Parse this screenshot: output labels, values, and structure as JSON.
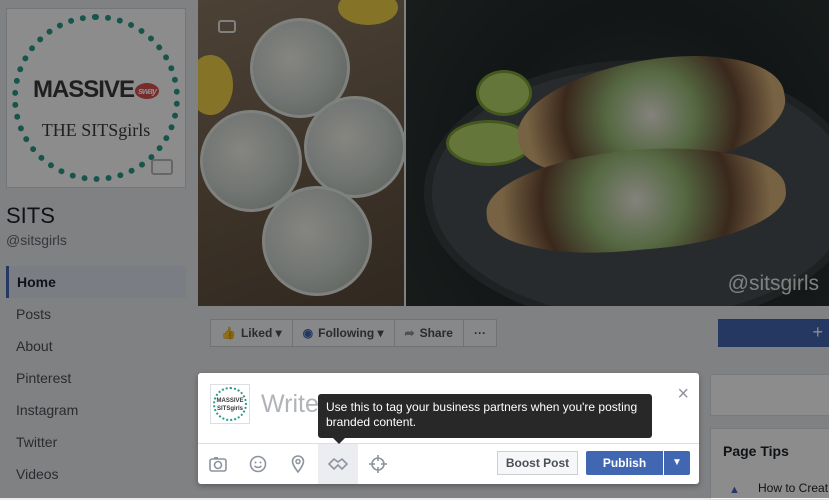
{
  "page": {
    "name": "SITS",
    "handle": "@sitsgirls",
    "logo_line1": "MASSIVE",
    "logo_badge": "sway",
    "logo_line2": "THE SITSgirls"
  },
  "nav": {
    "items": [
      {
        "label": "Home",
        "active": true
      },
      {
        "label": "Posts"
      },
      {
        "label": "About"
      },
      {
        "label": "Pinterest"
      },
      {
        "label": "Instagram"
      },
      {
        "label": "Twitter"
      },
      {
        "label": "Videos"
      }
    ]
  },
  "cover": {
    "watermark": "@sitsgirls"
  },
  "action_bar": {
    "liked_label": "Liked",
    "following_label": "Following",
    "share_label": "Share",
    "more_label": "···",
    "plus_label": "+"
  },
  "composer": {
    "placeholder": "Write",
    "close_label": "×",
    "boost_label": "Boost Post",
    "publish_label": "Publish",
    "dropdown_label": "▼",
    "avatar_label": "MASSIVE SITSgirls"
  },
  "tooltip": {
    "text": "Use this to tag your business partners when you're posting branded content."
  },
  "sidebar": {
    "page_tips_title": "Page Tips",
    "page_tips_item": "How to Creat"
  },
  "icons": {
    "photo": "camera-icon",
    "feeling": "smiley-icon",
    "location": "location-pin-icon",
    "branded": "handshake-icon",
    "target": "crosshair-icon"
  },
  "colors": {
    "brand_blue": "#4267b2",
    "logo_teal": "#2b9b8a",
    "logo_red": "#d9534f"
  }
}
